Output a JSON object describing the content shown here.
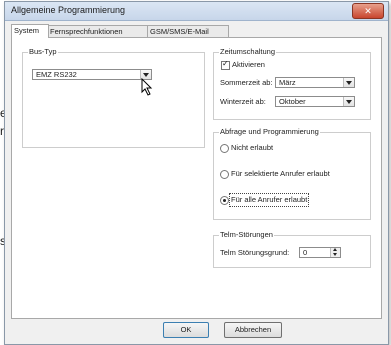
{
  "background_fragments": [
    "e",
    "r",
    "s"
  ],
  "window": {
    "title": "Allgemeine Programmierung",
    "close_label": "✕"
  },
  "tabs": [
    {
      "label": "System",
      "active": true
    },
    {
      "label": "Fernsprechfunktionen",
      "active": false
    },
    {
      "label": "GSM/SMS/E-Mail",
      "active": false
    }
  ],
  "bus_type": {
    "group_label": "Bus-Typ",
    "value": "EMZ RS232"
  },
  "time_switch": {
    "group_label": "Zeitumschaltung",
    "activate_label": "Aktivieren",
    "activate_checked": true,
    "summer_label": "Sommerzeit ab:",
    "summer_value": "März",
    "winter_label": "Winterzeit ab:",
    "winter_value": "Oktober"
  },
  "query": {
    "group_label": "Abfrage und Programmierung",
    "options": [
      {
        "label": "Nicht erlaubt",
        "selected": false
      },
      {
        "label": "Für selektierte Anrufer erlaubt",
        "selected": false
      },
      {
        "label": "Für alle Anrufer erlaubt",
        "selected": true
      }
    ]
  },
  "telm": {
    "group_label": "Telm-Störungen",
    "field_label": "Telm Störungsgrund:",
    "value": "0"
  },
  "footer": {
    "ok_label": "OK",
    "cancel_label": "Abbrechen"
  }
}
